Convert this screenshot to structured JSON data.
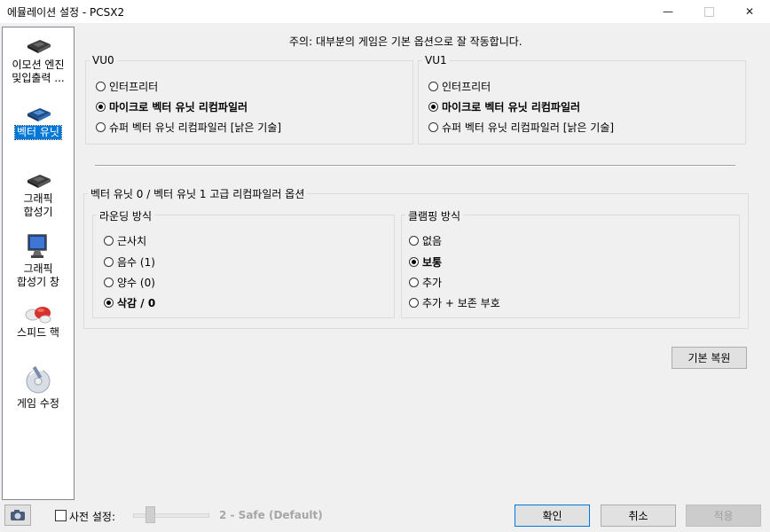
{
  "window": {
    "title": "에뮬레이션 설정 - PCSX2",
    "minimize": "—",
    "close": "✕"
  },
  "sidebar": {
    "items": [
      {
        "label1": "이모션 엔진",
        "label2": "및입출력 ...",
        "icon": "chip-icon"
      },
      {
        "label1": "벡터 유닛",
        "icon": "chip-blue-icon",
        "selected": true
      },
      {
        "label1": "그래픽",
        "label2": "합성기",
        "icon": "chip-icon"
      },
      {
        "label1": "그래픽",
        "label2": "합성기 창",
        "icon": "monitor-icon"
      },
      {
        "label1": "스피드 핵",
        "icon": "pills-icon"
      },
      {
        "label1": "게임 수정",
        "icon": "disc-wrench-icon"
      }
    ]
  },
  "notice": "주의: 대부분의 게임은 기본 옵션으로 잘 작동합니다.",
  "vu0": {
    "title": "VU0",
    "options": [
      "인터프리터",
      "마이크로 벡터 유닛 리컴파일러",
      "슈퍼 벡터 유닛 리컴파일러 [낡은 기술]"
    ],
    "selected": 1
  },
  "vu1": {
    "title": "VU1",
    "options": [
      "인터프리터",
      "마이크로 벡터 유닛 리컴파일러",
      "슈퍼 벡터 유닛 리컴파일러 [낡은 기술]"
    ],
    "selected": 1
  },
  "advanced": {
    "title": "벡터 유닛 0 / 벡터 유닛 1 고급 리컴파일러 옵션",
    "rounding": {
      "title": "라운딩 방식",
      "options": [
        "근사치",
        "음수 (1)",
        "양수 (0)",
        "삭감 / 0"
      ],
      "selected": 3
    },
    "clamping": {
      "title": "클램핑 방식",
      "options": [
        "없음",
        "보통",
        "추가",
        "추가 + 보존 부호"
      ],
      "selected": 1
    }
  },
  "buttons": {
    "restore_defaults": "기본 복원",
    "ok": "확인",
    "cancel": "취소",
    "apply": "적용"
  },
  "preset": {
    "label": "사전 설정:",
    "value": "2 - Safe (Default)",
    "checked": false
  }
}
